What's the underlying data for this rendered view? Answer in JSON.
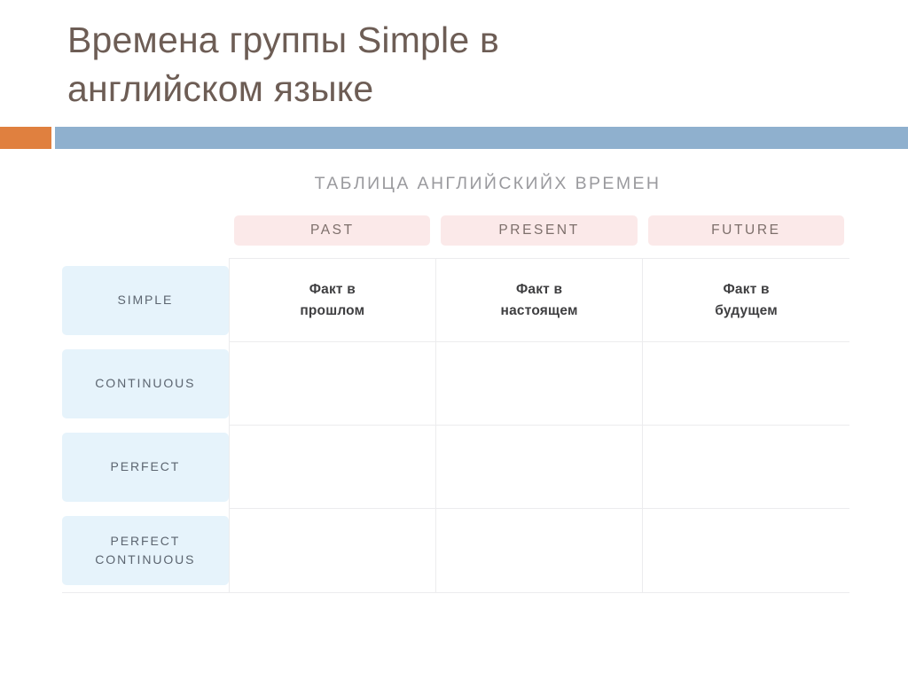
{
  "slide": {
    "title": "Времена группы Simple в\nанглийском языке",
    "title_color": "#6d5d55",
    "accent_color": "#e0803f",
    "bar_color": "#8fb0ce"
  },
  "table": {
    "caption": "ТАБЛИЦА АНГЛИЙСКИЙХ ВРЕМЕН",
    "caption_color": "#9a9a9e",
    "column_header_bg": "#fbe9e9",
    "row_label_bg": "#e6f3fb",
    "grid_color": "#ececee",
    "corner_label": "",
    "columns": [
      {
        "label": "PAST"
      },
      {
        "label": "PRESENT"
      },
      {
        "label": "FUTURE"
      }
    ],
    "rows": [
      {
        "label": "SIMPLE",
        "cells": [
          "Факт в\nпрошлом",
          "Факт в\nнастоящем",
          "Факт в\nбудущем"
        ]
      },
      {
        "label": "CONTINUOUS",
        "cells": [
          "",
          "",
          ""
        ]
      },
      {
        "label": "PERFECT",
        "cells": [
          "",
          "",
          ""
        ]
      },
      {
        "label": "PERFECT\nCONTINUOUS",
        "cells": [
          "",
          "",
          ""
        ]
      }
    ]
  }
}
